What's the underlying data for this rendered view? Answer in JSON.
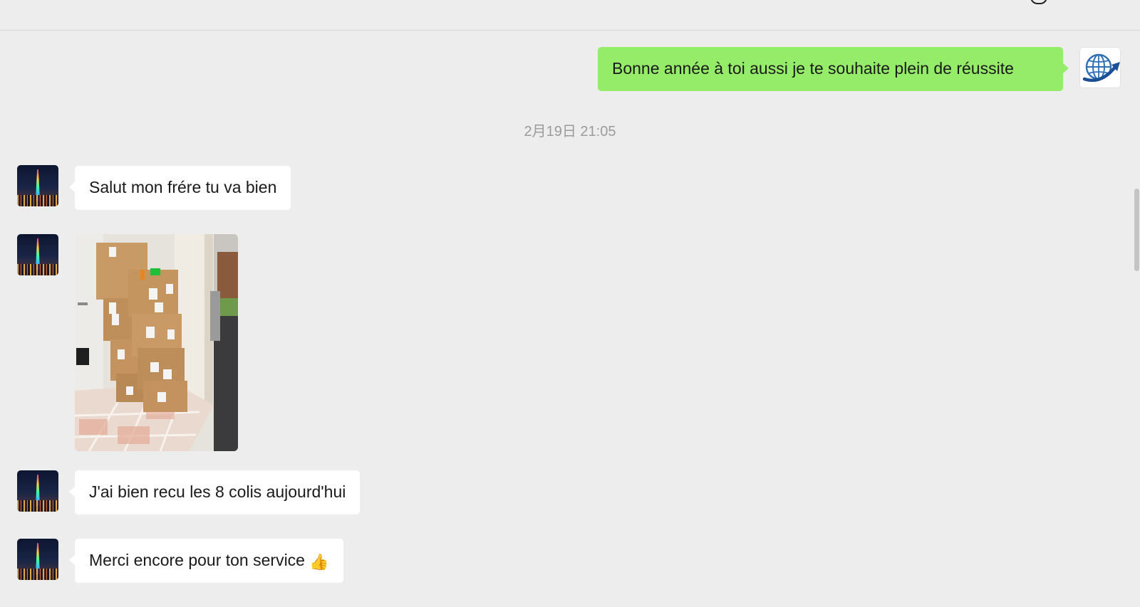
{
  "header": {
    "icon": "chat-bubble-icon"
  },
  "messages": [
    {
      "sender": "self",
      "type": "text",
      "text": "Bonne année à toi aussi je te souhaite plein de réussite",
      "avatar_icon": "globe-arrow-icon"
    },
    {
      "type": "timestamp",
      "text": "2月19日 21:05"
    },
    {
      "sender": "contact",
      "type": "text",
      "text": "Salut mon frére tu va bien",
      "avatar_icon": "city-tower-avatar"
    },
    {
      "sender": "contact",
      "type": "image",
      "alt": "photo",
      "avatar_icon": "city-tower-avatar"
    },
    {
      "sender": "contact",
      "type": "text",
      "text": "J'ai bien recu les 8 colis aujourd'hui",
      "avatar_icon": "city-tower-avatar"
    },
    {
      "sender": "contact",
      "type": "text",
      "text": "Merci encore pour ton service",
      "emoji": "👍",
      "avatar_icon": "city-tower-avatar"
    }
  ],
  "colors": {
    "background": "#ededed",
    "outgoing_bubble": "#95ec69",
    "incoming_bubble": "#ffffff",
    "timestamp": "#9b9b9b"
  }
}
